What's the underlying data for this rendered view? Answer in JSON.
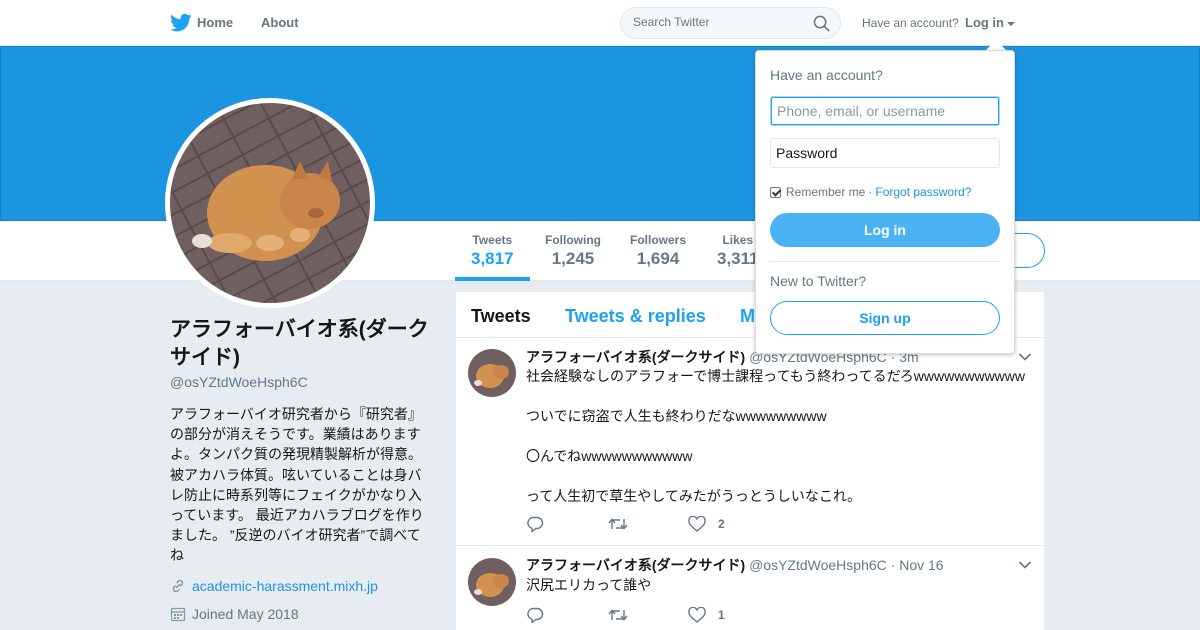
{
  "nav": {
    "home_label": "Home",
    "about_label": "About",
    "search_placeholder": "Search Twitter",
    "have_account": "Have an account?",
    "login_label": "Log in"
  },
  "colors": {
    "brand": "#1da1f2",
    "banner": "#1b95e0",
    "login_button": "#4ab3f4"
  },
  "stats": [
    {
      "label": "Tweets",
      "value": "3,817"
    },
    {
      "label": "Following",
      "value": "1,245"
    },
    {
      "label": "Followers",
      "value": "1,694"
    },
    {
      "label": "Likes",
      "value": "3,311"
    }
  ],
  "profile": {
    "name": "アラフォーバイオ系(ダークサイド)",
    "handle": "@osYZtdWoeHsph6C",
    "bio": "アラフォーバイオ研究者から『研究者』の部分が消えそうです。業績はありますよ。タンパク質の発現精製解析が得意。被アカハラ体質。呟いていることは身バレ防止に時系列等にフェイクがかなり入っています。 最近アカハラブログを作りました。 ”反逆のバイオ研究者”で調べてね",
    "link": "academic-harassment.mixh.jp",
    "joined": "Joined May 2018"
  },
  "timeline": {
    "tabs": [
      "Tweets",
      "Tweets & replies",
      "Media"
    ],
    "tweets": [
      {
        "name": "アラフォーバイオ系(ダークサイド)",
        "handle": "@osYZtdWoeHsph6C",
        "sep": "·",
        "time": "3m",
        "text": "社会経験なしのアラフォーで博士課程ってもう終わってるだろwwwwwwwwwww\n\nついでに窃盗で人生も終わりだなwwwwwwwww\n\n〇んでねwwwwwwwwwww\n\nって人生初で草生やしてみたがうっとうしいなこれ。",
        "likes": "2"
      },
      {
        "name": "アラフォーバイオ系(ダークサイド)",
        "handle": "@osYZtdWoeHsph6C",
        "sep": "·",
        "time": "Nov 16",
        "text": "沢尻エリカって誰や",
        "likes": "1"
      }
    ]
  },
  "login_dropdown": {
    "title": "Have an account?",
    "username_placeholder": "Phone, email, or username",
    "password_placeholder": "Password",
    "remember_me": "Remember me",
    "separator": "·",
    "forgot_password": "Forgot password?",
    "login_button": "Log in",
    "new_to_twitter": "New to Twitter?",
    "signup_button": "Sign up"
  }
}
